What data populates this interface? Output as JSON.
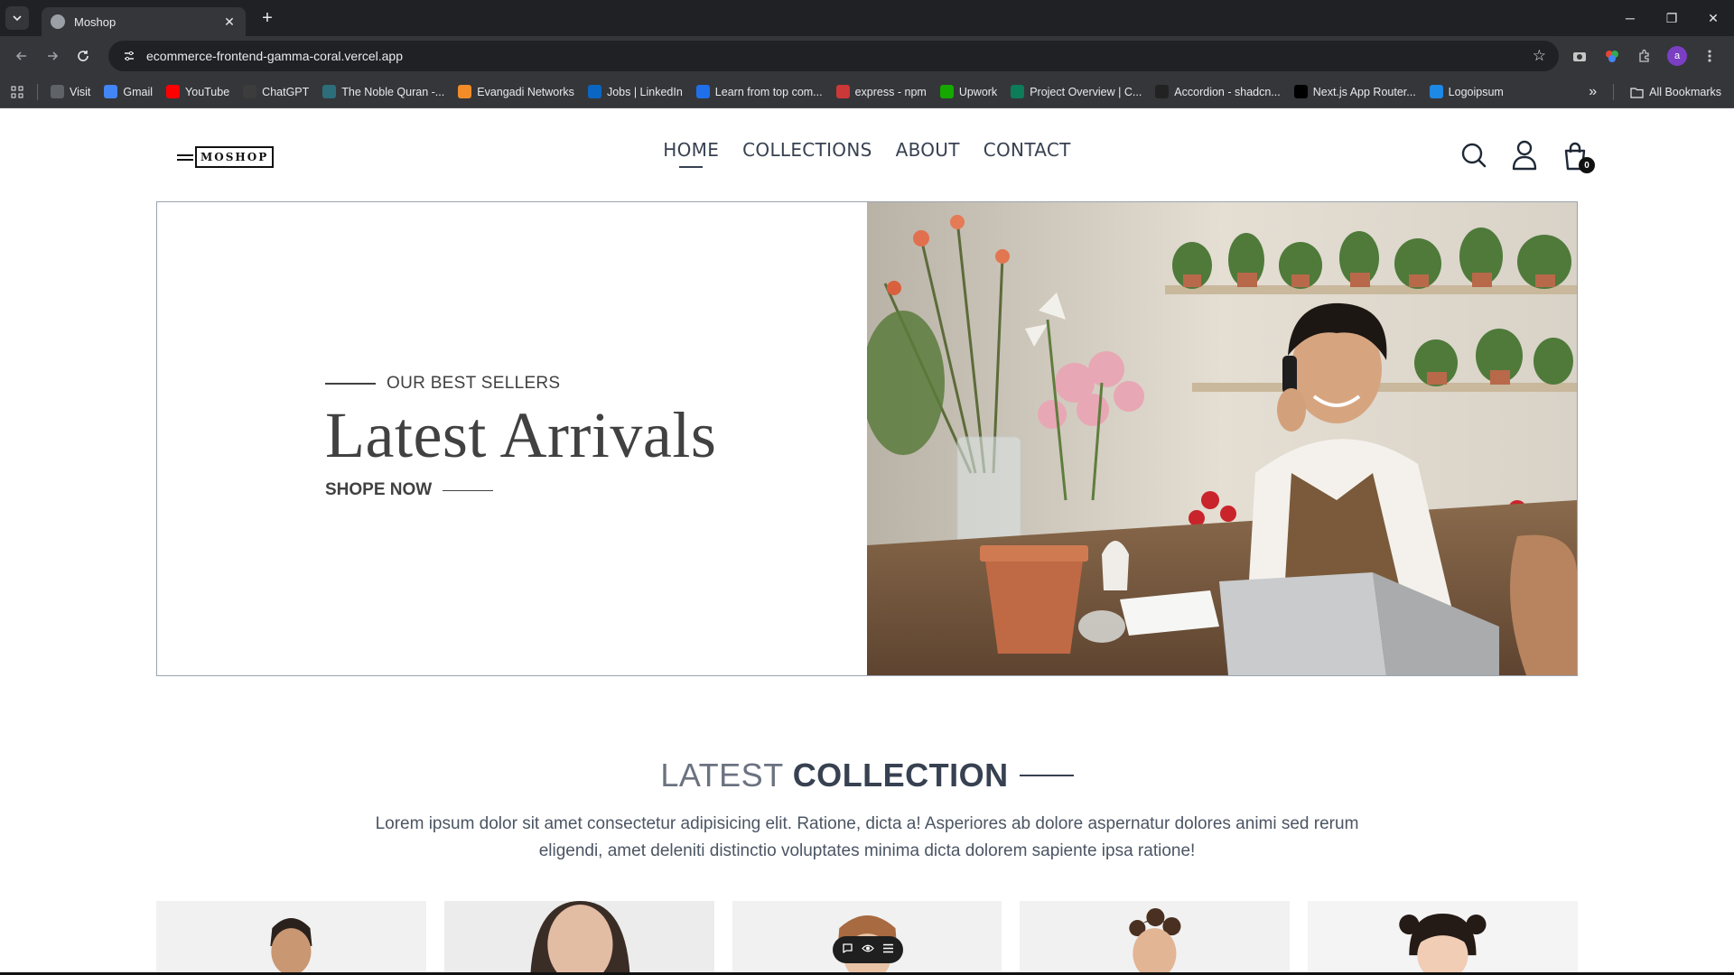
{
  "browser": {
    "tab_title": "Moshop",
    "tab_close": "✕",
    "new_tab": "+",
    "url": "ecommerce-frontend-gamma-coral.vercel.app",
    "window_controls": [
      "─",
      "❐",
      "✕"
    ],
    "profile_initial": "a",
    "bookmarks": [
      {
        "label": "Visit",
        "icon": "visit-icon",
        "color": "#5f6368"
      },
      {
        "label": "Gmail",
        "icon": "google-icon",
        "color": "#4285f4"
      },
      {
        "label": "YouTube",
        "icon": "youtube-icon",
        "color": "#ff0000"
      },
      {
        "label": "ChatGPT",
        "icon": "chatgpt-icon",
        "color": "#3c3c3c"
      },
      {
        "label": "The Noble Quran -...",
        "icon": "quran-icon",
        "color": "#2c6e7a"
      },
      {
        "label": "Evangadi Networks",
        "icon": "evangadi-icon",
        "color": "#f28c28"
      },
      {
        "label": "Jobs | LinkedIn",
        "icon": "linkedin-icon",
        "color": "#0a66c2"
      },
      {
        "label": "Learn from top com...",
        "icon": "learn-icon",
        "color": "#1f6feb"
      },
      {
        "label": "express - npm",
        "icon": "npm-icon",
        "color": "#cb3837"
      },
      {
        "label": "Upwork",
        "icon": "upwork-icon",
        "color": "#14a800"
      },
      {
        "label": "Project Overview | C...",
        "icon": "project-icon",
        "color": "#0c7c59"
      },
      {
        "label": "Accordion - shadcn...",
        "icon": "shadcn-icon",
        "color": "#222222"
      },
      {
        "label": "Next.js App Router...",
        "icon": "nextjs-icon",
        "color": "#000000"
      },
      {
        "label": "Logoipsum",
        "icon": "logoipsum-icon",
        "color": "#1e88e5"
      }
    ],
    "overflow": "»",
    "all_bookmarks": "All Bookmarks"
  },
  "site": {
    "logo_text": "MOSHOP",
    "nav": [
      {
        "label": "HOME",
        "active": true
      },
      {
        "label": "COLLECTIONS",
        "active": false
      },
      {
        "label": "ABOUT",
        "active": false
      },
      {
        "label": "CONTACT",
        "active": false
      }
    ],
    "cart_count": "0"
  },
  "hero": {
    "eyebrow": "OUR BEST SELLERS",
    "title": "Latest Arrivals",
    "cta": "SHOPE NOW"
  },
  "collection": {
    "title_light": "LATEST",
    "title_bold": "COLLECTION",
    "description": "Lorem ipsum dolor sit amet consectetur adipisicing elit. Ratione, dicta a! Asperiores ab dolore aspernatur dolores animi sed rerum eligendi, amet deleniti distinctio voluptates minima dicta dolorem sapiente ipsa ratione!"
  },
  "floating_toolbar": {
    "items": [
      "comment-icon",
      "eye-icon",
      "menu-icon"
    ]
  }
}
